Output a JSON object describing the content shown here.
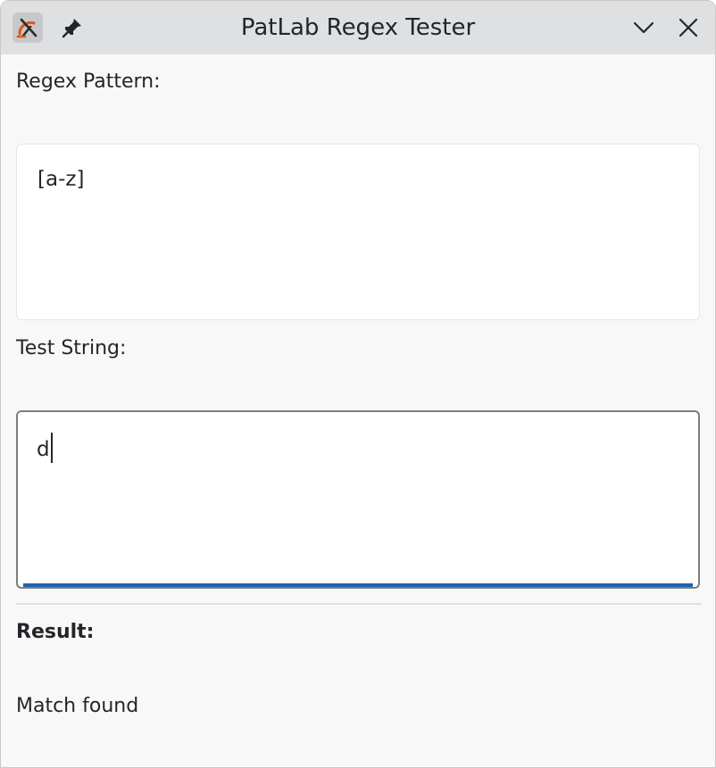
{
  "window": {
    "title": "PatLab Regex Tester",
    "accent_color": "#1d63b0",
    "icons": {
      "app": "regex-app-icon",
      "pin": "pin-icon",
      "minimize": "chevron-down-icon",
      "close": "close-icon"
    }
  },
  "form": {
    "pattern_label": "Regex Pattern:",
    "pattern_value": "[a-z]",
    "test_label": "Test String:",
    "test_value": "d"
  },
  "result": {
    "label": "Result:",
    "status": "Match found"
  }
}
